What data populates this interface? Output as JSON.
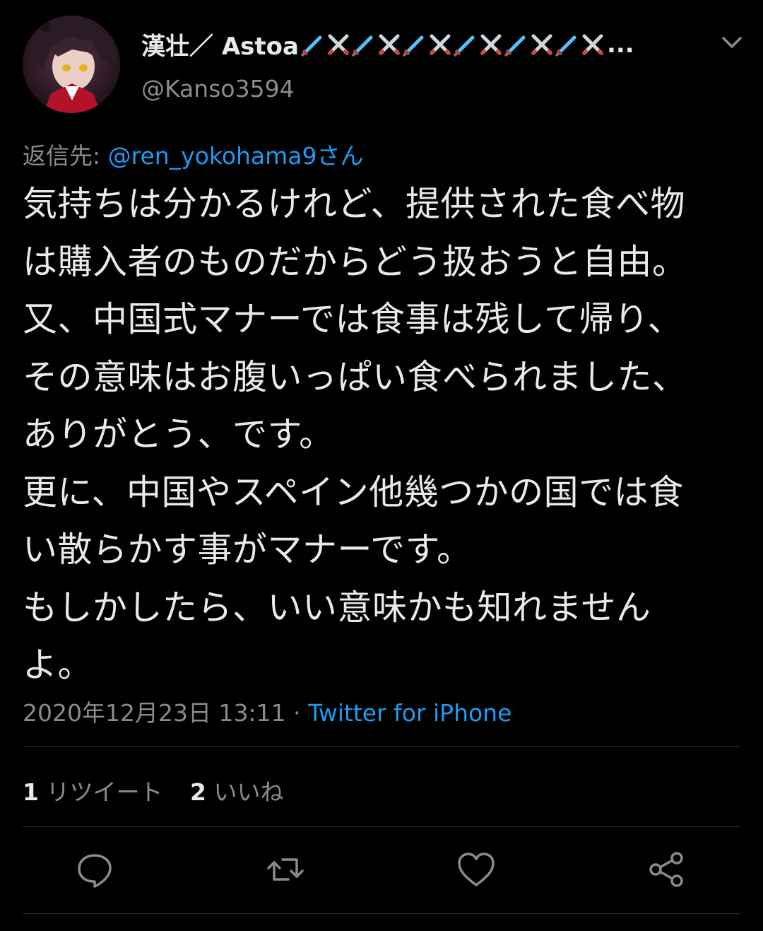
{
  "author": {
    "display_name": "漢壮／ Astoa",
    "name_emoji_icons": [
      "dagger-icon",
      "crossed-swords-icon",
      "dagger-icon",
      "crossed-swords-icon",
      "dagger-icon",
      "crossed-swords-icon",
      "dagger-icon",
      "crossed-swords-icon",
      "dagger-icon",
      "crossed-swords-icon",
      "dagger-icon",
      "crossed-swords-icon"
    ],
    "truncation": "...",
    "handle": "@Kanso3594"
  },
  "reply_to": {
    "prefix": "返信先: ",
    "mention": "@ren_yokohama9",
    "suffix": "さん"
  },
  "body_lines": [
    "気持ちは分かるけれど、提供された食べ物",
    "は購入者のものだからどう扱おうと自由。",
    "又、中国式マナーでは食事は残して帰り、",
    "その意味はお腹いっぱい食べられました、",
    "ありがとう、です。",
    "更に、中国やスペイン他幾つかの国では食",
    "い散らかす事がマナーです。",
    "もしかしたら、いい意味かも知れません",
    "よ。"
  ],
  "meta": {
    "timestamp": "2020年12月23日 13:11",
    "separator": " · ",
    "source": "Twitter for iPhone"
  },
  "stats": {
    "retweets_count": "1",
    "retweets_label": "リツイート",
    "likes_count": "2",
    "likes_label": "いいね"
  },
  "actions": [
    "reply-icon",
    "retweet-icon",
    "like-icon",
    "share-icon"
  ],
  "colors": {
    "background": "#000000",
    "text": "#e7e9ea",
    "secondary": "#8b8b8b",
    "accent": "#1d9bf0",
    "divider": "#2f3336"
  }
}
